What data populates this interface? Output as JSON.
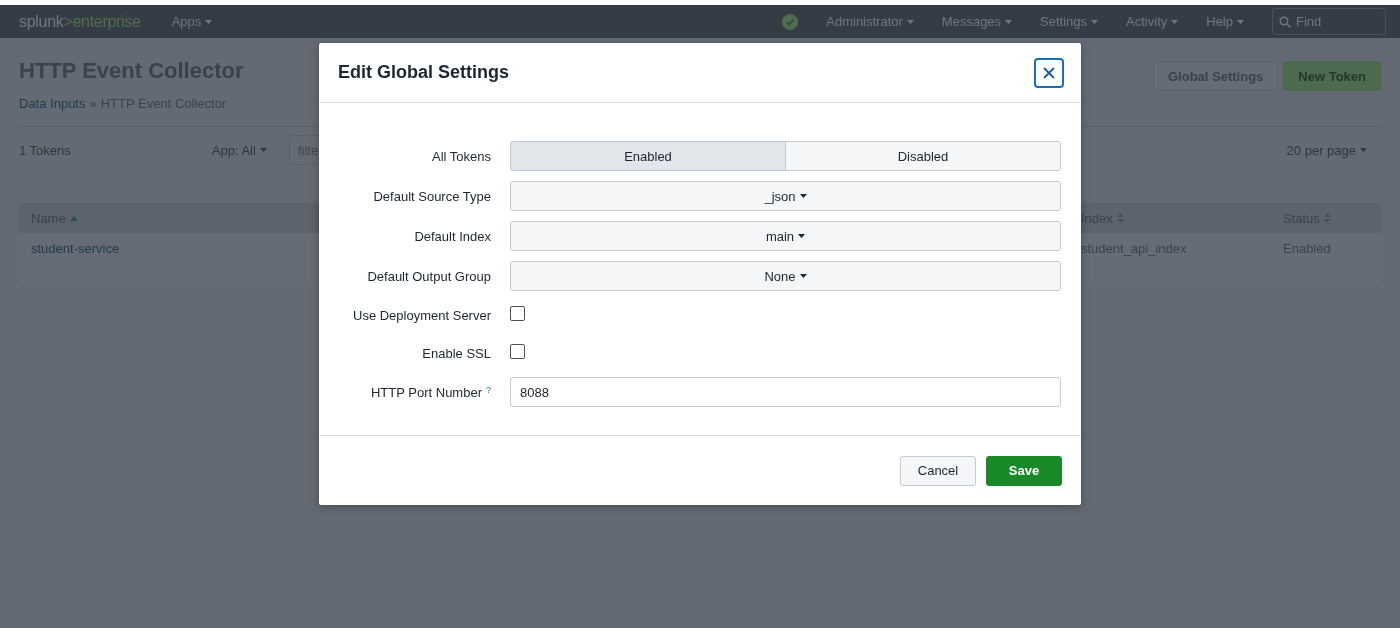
{
  "topbar": {
    "logo": {
      "brand": "splunk",
      "product": ">enterprise"
    },
    "left_menus": [
      {
        "label": "Apps"
      }
    ],
    "right_menus": [
      {
        "label": "Administrator"
      },
      {
        "label": "Messages"
      },
      {
        "label": "Settings"
      },
      {
        "label": "Activity"
      },
      {
        "label": "Help"
      }
    ],
    "search": {
      "placeholder": "Find"
    }
  },
  "page": {
    "title": "HTTP Event Collector",
    "breadcrumb": {
      "link": "Data Inputs",
      "separator": "»",
      "current": "HTTP Event Collector"
    },
    "buttons": [
      {
        "label": "Global Settings",
        "kind": "secondary"
      },
      {
        "label": "New Token",
        "kind": "primary"
      }
    ],
    "toolbar": {
      "count": "1 Tokens",
      "app_filter": "App: All",
      "filter_placeholder": "filte",
      "per_page": "20 per page"
    },
    "table": {
      "columns": [
        {
          "label": "Name",
          "sorted": true
        },
        {
          "label": "Index",
          "sorted": false
        },
        {
          "label": "Status",
          "sorted": false
        }
      ],
      "rows": [
        {
          "cells": [
            "student-service",
            "student_api_index",
            "Enabled"
          ]
        }
      ]
    }
  },
  "dialog": {
    "title": "Edit Global Settings",
    "fields": [
      {
        "kind": "toggle",
        "label": "All Tokens",
        "options": [
          {
            "label": "Enabled",
            "selected": true
          },
          {
            "label": "Disabled",
            "selected": false
          }
        ]
      },
      {
        "kind": "dropdown",
        "label": "Default Source Type",
        "value": "_json"
      },
      {
        "kind": "dropdown",
        "label": "Default Index",
        "value": "main"
      },
      {
        "kind": "dropdown",
        "label": "Default Output Group",
        "value": "None"
      },
      {
        "kind": "checkbox",
        "label": "Use Deployment Server",
        "checked": false
      },
      {
        "kind": "checkbox",
        "label": "Enable SSL",
        "checked": false
      },
      {
        "kind": "text",
        "label": "HTTP Port Number",
        "help": "?",
        "value": "8088"
      }
    ],
    "buttons": [
      {
        "label": "Cancel",
        "kind": "secondary"
      },
      {
        "label": "Save",
        "kind": "primary"
      }
    ]
  }
}
